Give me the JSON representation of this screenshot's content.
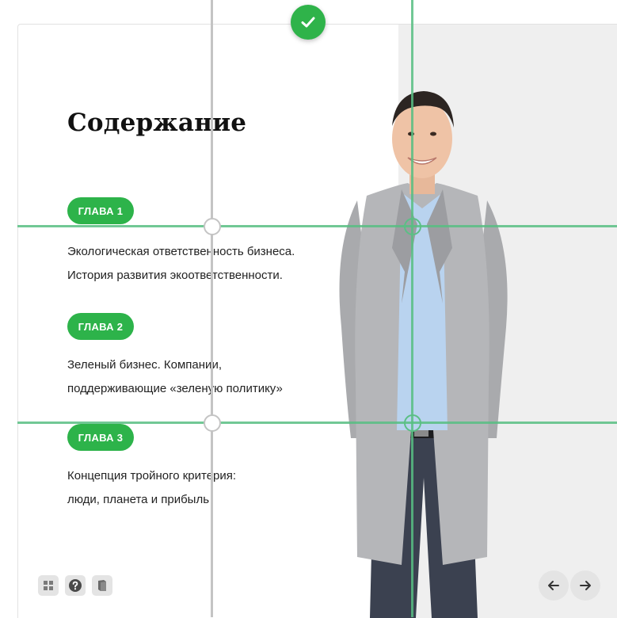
{
  "slide": {
    "title": "Содержание",
    "chapters": [
      {
        "label": "ГЛАВА 1",
        "lines": [
          "Экологическая ответственность бизнеса.",
          "История развития экоответственности."
        ]
      },
      {
        "label": "ГЛАВА 2",
        "lines": [
          "Зеленый бизнес. Компании,",
          "поддерживающие «зеленую политику»"
        ]
      },
      {
        "label": "ГЛАВА 3",
        "lines": [
          "Концепция тройного критерия:",
          "люди, планета и прибыль"
        ]
      }
    ]
  },
  "icons": {
    "confirm": "checkmark-icon",
    "grid": "grid-icon",
    "help": "question-icon",
    "book": "book-icon",
    "prev": "arrow-left-icon",
    "next": "arrow-right-icon"
  },
  "colors": {
    "accent": "#2db34a",
    "guide_green": "#58be82",
    "guide_grey": "#c4c4c4",
    "panel": "#efefef"
  }
}
